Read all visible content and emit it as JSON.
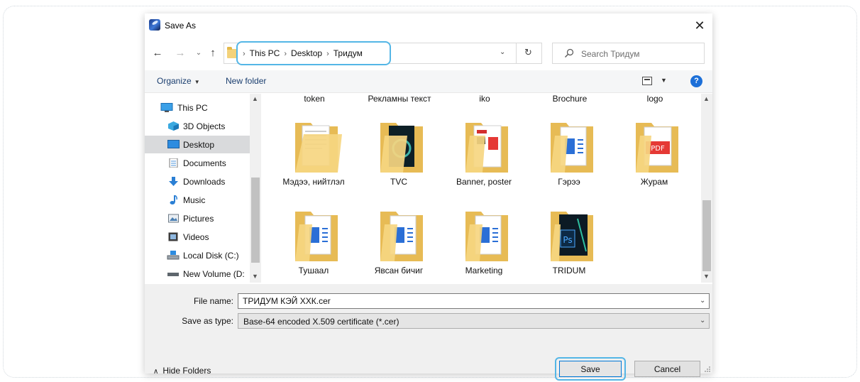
{
  "dialog": {
    "title": "Save As",
    "close_glyph": "✕"
  },
  "address": {
    "crumbs": [
      "This PC",
      "Desktop",
      "Тридум"
    ],
    "separator": "›"
  },
  "search": {
    "placeholder": "Search Тридум"
  },
  "toolbar": {
    "organize_label": "Organize",
    "new_folder_label": "New folder",
    "help_label": "?"
  },
  "nav_pane": {
    "items": [
      {
        "label": "This PC",
        "icon": "this-pc-icon",
        "selected": false
      },
      {
        "label": "3D Objects",
        "icon": "3d-objects-icon",
        "selected": false
      },
      {
        "label": "Desktop",
        "icon": "desktop-icon",
        "selected": true
      },
      {
        "label": "Documents",
        "icon": "documents-icon",
        "selected": false
      },
      {
        "label": "Downloads",
        "icon": "downloads-icon",
        "selected": false
      },
      {
        "label": "Music",
        "icon": "music-icon",
        "selected": false
      },
      {
        "label": "Pictures",
        "icon": "pictures-icon",
        "selected": false
      },
      {
        "label": "Videos",
        "icon": "videos-icon",
        "selected": false
      },
      {
        "label": "Local Disk (C:)",
        "icon": "local-disk-icon",
        "selected": false
      },
      {
        "label": "New Volume (D:",
        "icon": "drive-icon",
        "selected": false
      }
    ]
  },
  "files": {
    "partial_row_labels": [
      "token",
      "Рекламны текст",
      "iko",
      "Brochure",
      "logo"
    ],
    "items": [
      {
        "label": "Мэдээ, нийтлэл",
        "thumb": "document"
      },
      {
        "label": "TVC",
        "thumb": "media"
      },
      {
        "label": "Banner, poster",
        "thumb": "banner"
      },
      {
        "label": "Гэрээ",
        "thumb": "word"
      },
      {
        "label": "Журам",
        "thumb": "pdf"
      },
      {
        "label": "Тушаал",
        "thumb": "word"
      },
      {
        "label": "Явсан бичиг",
        "thumb": "word"
      },
      {
        "label": "Marketing",
        "thumb": "word"
      },
      {
        "label": "TRIDUM",
        "thumb": "photoshop"
      }
    ]
  },
  "form": {
    "file_name_label": "File name:",
    "file_name_value": "ТРИДУМ КЭЙ ХХК.cer",
    "save_type_label": "Save as type:",
    "save_type_value": "Base-64 encoded X.509 certificate (*.cer)",
    "hide_folders_label": "Hide Folders",
    "save_label": "Save",
    "cancel_label": "Cancel"
  },
  "colors": {
    "highlight": "#54b6e6",
    "folder": "#f3d27a",
    "word_blue": "#2b6fd6",
    "pdf_red": "#e53935"
  }
}
